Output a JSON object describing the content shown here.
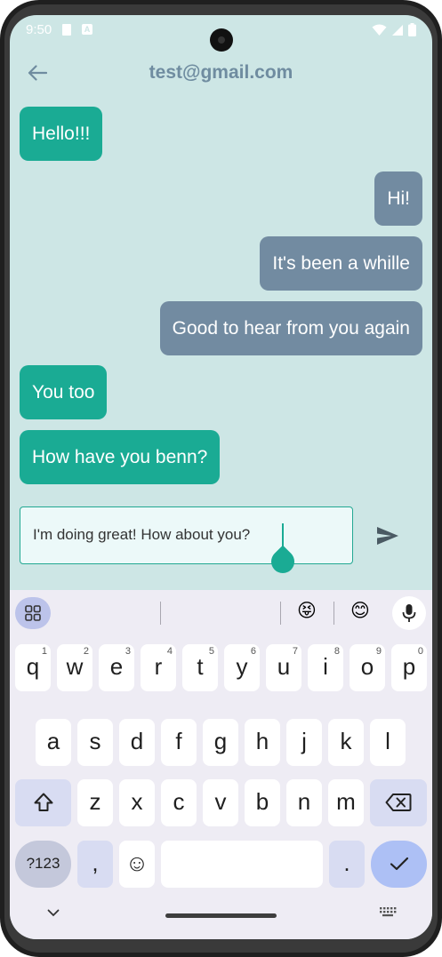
{
  "status_bar": {
    "time": "9:50",
    "badge": "A"
  },
  "app_bar": {
    "title": "test@gmail.com"
  },
  "messages": [
    {
      "text": "Hello!!!",
      "direction": "incoming"
    },
    {
      "text": "Hi!",
      "direction": "outgoing"
    },
    {
      "text": "It's been a whille",
      "direction": "outgoing"
    },
    {
      "text": "Good to hear from you again",
      "direction": "outgoing"
    },
    {
      "text": "You too",
      "direction": "incoming"
    },
    {
      "text": "How have you benn?",
      "direction": "incoming"
    }
  ],
  "composer": {
    "value": "I'm doing great! How about you?"
  },
  "keyboard": {
    "row1": [
      "q",
      "w",
      "e",
      "r",
      "t",
      "y",
      "u",
      "i",
      "o",
      "p"
    ],
    "row1_hints": [
      "1",
      "2",
      "3",
      "4",
      "5",
      "6",
      "7",
      "8",
      "9",
      "0"
    ],
    "row2": [
      "a",
      "s",
      "d",
      "f",
      "g",
      "h",
      "j",
      "k",
      "l"
    ],
    "row3": [
      "z",
      "x",
      "c",
      "v",
      "b",
      "n",
      "m"
    ],
    "symbols_label": "?123",
    "comma": ",",
    "period": ".",
    "emoji_1": "😝",
    "emoji_2": "😊",
    "emoji_key": "☺"
  },
  "colors": {
    "background": "#cde6e5",
    "incoming_bubble": "#1aab94",
    "outgoing_bubble": "#728ba1",
    "title": "#6f8ca0",
    "keyboard_bg": "#eeecf4"
  },
  "icons": [
    "back-arrow-icon",
    "send-icon",
    "apps-grid-icon",
    "mic-icon",
    "shift-icon",
    "backspace-icon",
    "check-icon",
    "chevron-down-icon",
    "keyboard-icon",
    "wifi-icon",
    "signal-icon",
    "battery-icon"
  ]
}
